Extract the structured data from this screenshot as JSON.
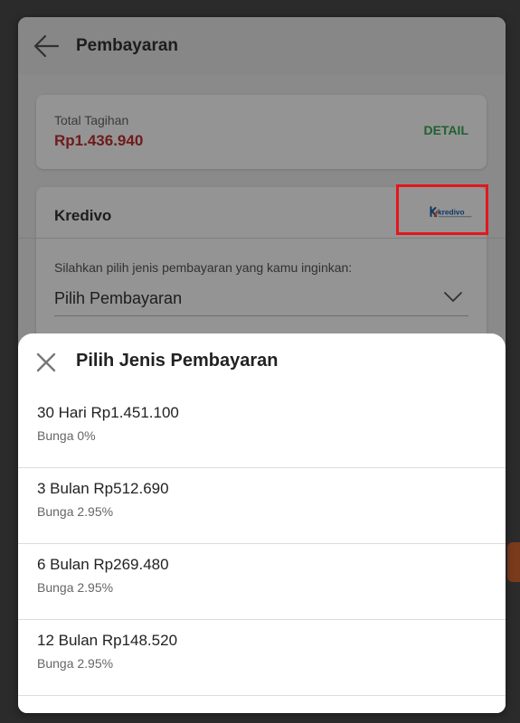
{
  "header": {
    "title": "Pembayaran"
  },
  "total": {
    "label": "Total Tagihan",
    "amount": "Rp1.436.940",
    "detail_label": "DETAIL"
  },
  "kredivo": {
    "title": "Kredivo",
    "logo_text": "kredivo",
    "instruction": "Silahkan pilih jenis pembayaran yang kamu inginkan:",
    "select_value": "Pilih Pembayaran"
  },
  "sheet": {
    "title": "Pilih Jenis Pembayaran",
    "options": [
      {
        "title": "30 Hari Rp1.451.100",
        "subtitle": "Bunga 0%"
      },
      {
        "title": "3 Bulan Rp512.690",
        "subtitle": "Bunga 2.95%"
      },
      {
        "title": "6 Bulan Rp269.480",
        "subtitle": "Bunga 2.95%"
      },
      {
        "title": "12 Bulan Rp148.520",
        "subtitle": "Bunga 2.95%"
      }
    ]
  },
  "colors": {
    "accent_green": "#3aa655",
    "amount_red": "#c0302f",
    "highlight_red": "#e4161c",
    "kredivo_blue": "#1a5fa8",
    "kredivo_orange": "#f05a28"
  }
}
